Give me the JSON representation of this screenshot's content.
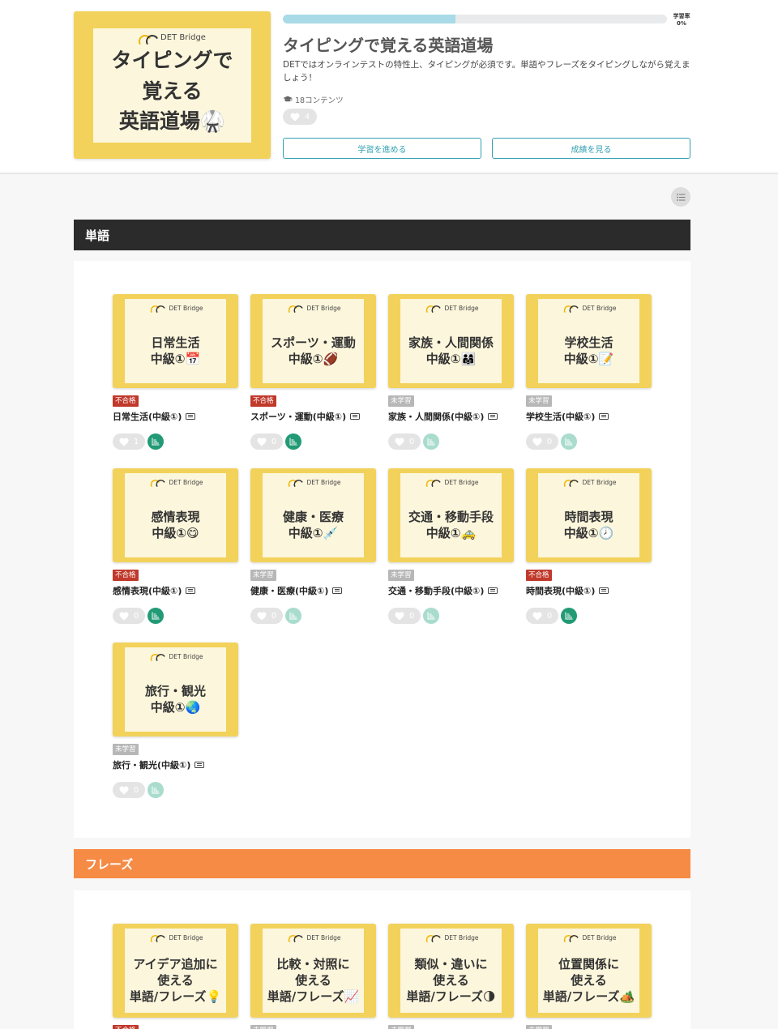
{
  "course": {
    "cover_brand": "DET Bridge",
    "cover_text": "タイピングで\n覚える\n英語道場🥋",
    "progress_percent": 45,
    "rate_label": "学習率",
    "rate_value": "0%",
    "title": "タイピングで覚える英語道場",
    "description": "DETではオンラインテストの特性上、タイピングが必須です。単語やフレーズをタイピングしながら覚えましょう！",
    "content_count": "18コンテンツ",
    "likes": "4",
    "continue_label": "学習を進める",
    "results_label": "成績を見る"
  },
  "colors": {
    "accent": "#33a1b1",
    "section_words": "#2b2b2b",
    "section_phrases": "#f68b45",
    "cover_yellow": "#f2d25a",
    "fail_red": "#c0392b",
    "chart_dark": "#229a76",
    "chart_light": "#a9dccd"
  },
  "sections": [
    {
      "title": "単語",
      "items": [
        {
          "brand": "DET Bridge",
          "thumb": "日常生活\n中級①📅",
          "status": "不合格",
          "status_type": "fail",
          "title": "日常生活(中級①)",
          "likes": "1",
          "chart": "dark"
        },
        {
          "brand": "DET Bridge",
          "thumb": "スポーツ・運動\n中級①🏈",
          "status": "不合格",
          "status_type": "fail",
          "title": "スポーツ・運動(中級①)",
          "likes": "0",
          "chart": "dark"
        },
        {
          "brand": "DET Bridge",
          "thumb": "家族・人間関係\n中級①👨‍👩‍👧",
          "status": "未学習",
          "status_type": "notyet",
          "title": "家族・人間関係(中級①)",
          "likes": "0",
          "chart": "light"
        },
        {
          "brand": "DET Bridge",
          "thumb": "学校生活\n中級①📝",
          "status": "未学習",
          "status_type": "notyet",
          "title": "学校生活(中級①)",
          "likes": "0",
          "chart": "light"
        },
        {
          "brand": "DET Bridge",
          "thumb": "感情表現\n中級①😋",
          "status": "不合格",
          "status_type": "fail",
          "title": "感情表現(中級①)",
          "likes": "0",
          "chart": "dark"
        },
        {
          "brand": "DET Bridge",
          "thumb": "健康・医療\n中級①💉",
          "status": "未学習",
          "status_type": "notyet",
          "title": "健康・医療(中級①)",
          "likes": "0",
          "chart": "light"
        },
        {
          "brand": "DET Bridge",
          "thumb": "交通・移動手段\n中級①🚕",
          "status": "未学習",
          "status_type": "notyet",
          "title": "交通・移動手段(中級①)",
          "likes": "0",
          "chart": "light"
        },
        {
          "brand": "DET Bridge",
          "thumb": "時間表現\n中級①🕗",
          "status": "不合格",
          "status_type": "fail",
          "title": "時間表現(中級①)",
          "likes": "0",
          "chart": "dark"
        },
        {
          "brand": "DET Bridge",
          "thumb": "旅行・観光\n中級①🌏",
          "status": "未学習",
          "status_type": "notyet",
          "title": "旅行・観光(中級①)",
          "likes": "0",
          "chart": "light"
        }
      ]
    },
    {
      "title": "フレーズ",
      "items": [
        {
          "brand": "DET Bridge",
          "thumb": "アイデア追加に\n使える\n単語/フレーズ💡",
          "status": "不合格",
          "status_type": "fail",
          "title": "",
          "likes": "",
          "chart": "dark"
        },
        {
          "brand": "DET Bridge",
          "thumb": "比較・対照に\n使える\n単語/フレーズ📈",
          "status": "未学習",
          "status_type": "notyet",
          "title": "",
          "likes": "",
          "chart": "light"
        },
        {
          "brand": "DET Bridge",
          "thumb": "類似・違いに\n使える\n単語/フレーズ🌗",
          "status": "未学習",
          "status_type": "notyet",
          "title": "",
          "likes": "",
          "chart": "light"
        },
        {
          "brand": "DET Bridge",
          "thumb": "位置関係に\n使える\n単語/フレーズ🏕️",
          "status": "未学習",
          "status_type": "notyet",
          "title": "",
          "likes": "",
          "chart": "light"
        }
      ]
    }
  ]
}
